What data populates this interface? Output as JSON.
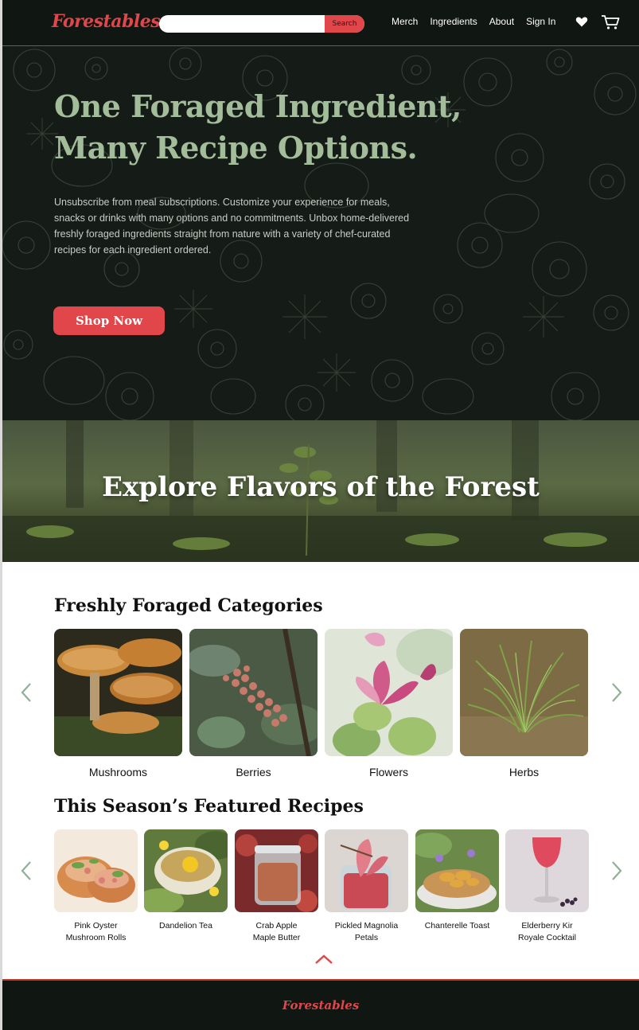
{
  "nav": {
    "logo": "Forestables",
    "search_placeholder": "",
    "search_button": "Search",
    "links": [
      "Merch",
      "Ingredients",
      "About",
      "Sign In"
    ],
    "icons": [
      "heart-icon",
      "cart-icon"
    ]
  },
  "hero": {
    "title_line1": "One Foraged Ingredient,",
    "title_line2": "Many Recipe Options.",
    "description": "Unsubscribe from meal subscriptions. Customize your experience for meals, snacks or drinks with many options and no commitments. Unbox home-delivered freshly foraged ingredients straight from nature with a variety of chef-curated recipes for each ingredient ordered.",
    "cta": "Shop Now"
  },
  "forest_banner": {
    "title": "Explore Flavors of the Forest"
  },
  "categories": {
    "title": "Freshly Foraged Categories",
    "items": [
      {
        "label": "Mushrooms"
      },
      {
        "label": "Berries"
      },
      {
        "label": "Flowers"
      },
      {
        "label": "Herbs"
      }
    ]
  },
  "recipes": {
    "title": "This Season’s Featured Recipes",
    "items": [
      {
        "line1": "Pink Oyster",
        "line2": "Mushroom Rolls"
      },
      {
        "line1": "Dandelion Tea",
        "line2": ""
      },
      {
        "line1": "Crab Apple",
        "line2": "Maple Butter"
      },
      {
        "line1": "Pickled Magnolia",
        "line2": "Petals"
      },
      {
        "line1": "Chanterelle Toast",
        "line2": ""
      },
      {
        "line1": "Elderberry Kir",
        "line2": "Royale Cocktail"
      }
    ]
  },
  "footer": {
    "logo": "Forestables"
  },
  "colors": {
    "accent": "#e0464a",
    "dark": "#101612",
    "hero_title": "#a3bc9a",
    "arrow": "#8fb096"
  }
}
